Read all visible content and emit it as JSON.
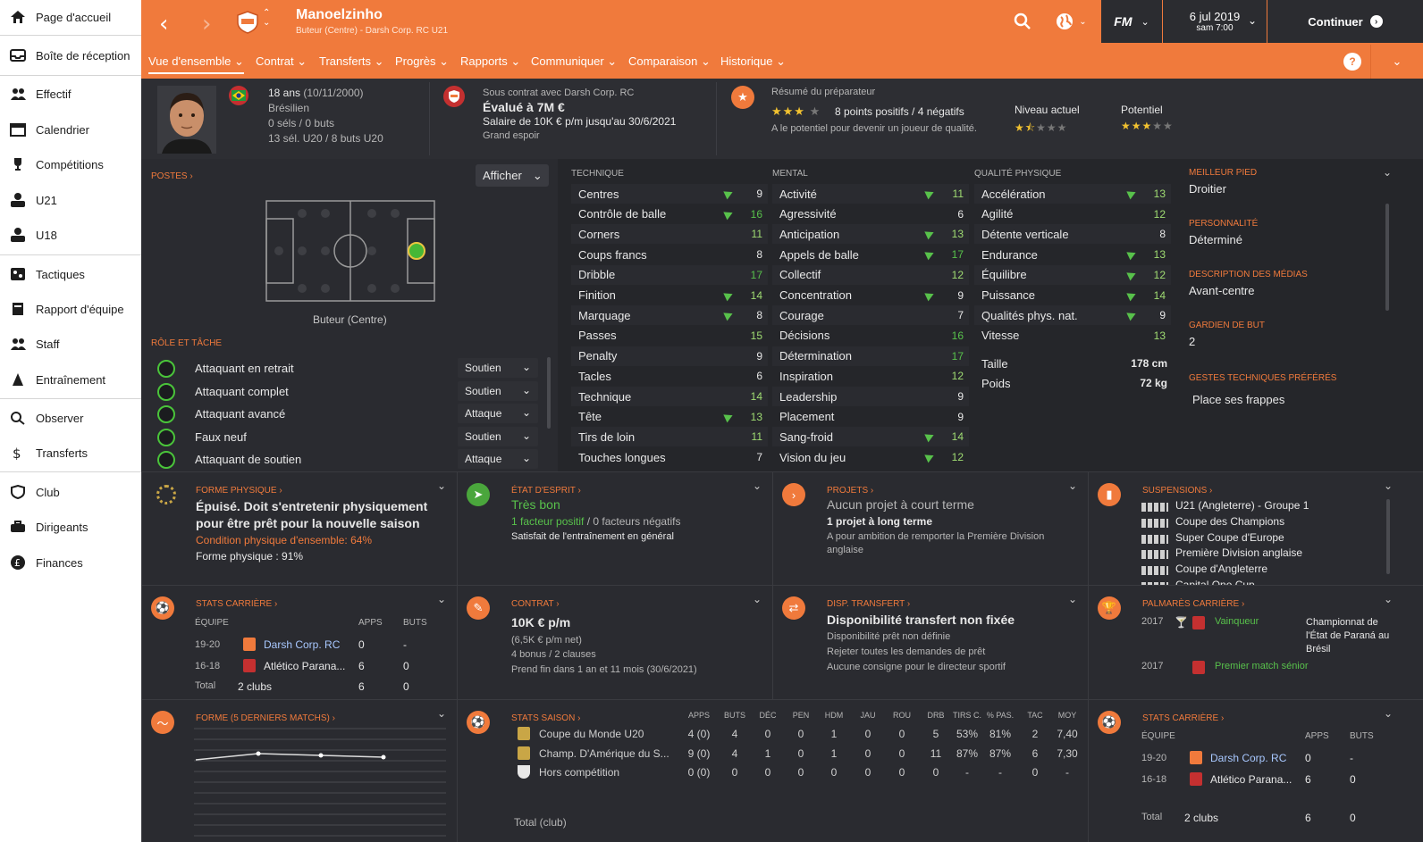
{
  "sidebar": {
    "items": [
      {
        "label": "Page d'accueil",
        "icon": "home-icon"
      },
      {
        "label": "Boîte de réception",
        "icon": "inbox-icon"
      },
      {
        "label": "Effectif",
        "icon": "squad-icon"
      },
      {
        "label": "Calendrier",
        "icon": "calendar-icon"
      },
      {
        "label": "Compétitions",
        "icon": "trophy-icon"
      },
      {
        "label": "U21",
        "icon": "u21-icon"
      },
      {
        "label": "U18",
        "icon": "u18-icon"
      },
      {
        "label": "Tactiques",
        "icon": "tactics-icon"
      },
      {
        "label": "Rapport d'équipe",
        "icon": "report-icon"
      },
      {
        "label": "Staff",
        "icon": "staff-icon"
      },
      {
        "label": "Entraînement",
        "icon": "training-icon"
      },
      {
        "label": "Observer",
        "icon": "search-icon"
      },
      {
        "label": "Transferts",
        "icon": "transfer-icon"
      },
      {
        "label": "Club",
        "icon": "shield-icon"
      },
      {
        "label": "Dirigeants",
        "icon": "board-icon"
      },
      {
        "label": "Finances",
        "icon": "finance-icon"
      }
    ]
  },
  "topbar": {
    "name": "Manoelzinho",
    "subtitle": "Buteur (Centre) - Darsh Corp. RC U21",
    "fm": "FM",
    "date": "6 jul 2019",
    "time": "sam 7:00",
    "continue": "Continuer",
    "help": "?"
  },
  "menu": [
    "Vue d'ensemble",
    "Contrat",
    "Transferts",
    "Progrès",
    "Rapports",
    "Communiquer",
    "Comparaison",
    "Historique"
  ],
  "header": {
    "age": "18 ans",
    "dob": "(10/11/2000)",
    "nationality": "Brésilien",
    "caps": "0 séls / 0 buts",
    "u20": "13 sél. U20 / 8 buts U20",
    "contract": "Sous contrat avec Darsh Corp. RC",
    "value": "Évalué à 7M €",
    "salary": "Salaire de 10K € p/m jusqu'au 30/6/2021",
    "status": "Grand espoir",
    "coach_title": "Résumé du préparateur",
    "coach_points": "8 points positifs / 4 négatifs",
    "coach_note": "A le potentiel pour devenir un joueur de qualité.",
    "coach_stars": 3,
    "current_label": "Niveau actuel",
    "current_stars": 1.5,
    "potential_label": "Potentiel",
    "potential_stars": 3
  },
  "positions": {
    "title": "POSTES",
    "show": "Afficher",
    "position": "Buteur (Centre)",
    "roles_title": "RÔLE ET TÂCHE",
    "roles": [
      {
        "name": "Attaquant en retrait",
        "duty": "Soutien"
      },
      {
        "name": "Attaquant complet",
        "duty": "Soutien"
      },
      {
        "name": "Attaquant avancé",
        "duty": "Attaque"
      },
      {
        "name": "Faux neuf",
        "duty": "Soutien"
      },
      {
        "name": "Attaquant de soutien",
        "duty": "Attaque"
      }
    ]
  },
  "attributes": {
    "technique_title": "TECHNIQUE",
    "mental_title": "MENTAL",
    "physical_title": "QUALITÉ PHYSIQUE",
    "technique": [
      {
        "n": "Centres",
        "v": "9",
        "up": true
      },
      {
        "n": "Contrôle de balle",
        "v": "16",
        "up": true
      },
      {
        "n": "Corners",
        "v": "11",
        "up": false
      },
      {
        "n": "Coups francs",
        "v": "8",
        "up": false
      },
      {
        "n": "Dribble",
        "v": "17",
        "up": false
      },
      {
        "n": "Finition",
        "v": "14",
        "up": true
      },
      {
        "n": "Marquage",
        "v": "8",
        "up": true
      },
      {
        "n": "Passes",
        "v": "15",
        "up": false
      },
      {
        "n": "Penalty",
        "v": "9",
        "up": false
      },
      {
        "n": "Tacles",
        "v": "6",
        "up": false
      },
      {
        "n": "Technique",
        "v": "14",
        "up": false
      },
      {
        "n": "Tête",
        "v": "13",
        "up": true
      },
      {
        "n": "Tirs de loin",
        "v": "11",
        "up": false
      },
      {
        "n": "Touches longues",
        "v": "7",
        "up": false
      }
    ],
    "mental": [
      {
        "n": "Activité",
        "v": "11",
        "up": true
      },
      {
        "n": "Agressivité",
        "v": "6",
        "up": false
      },
      {
        "n": "Anticipation",
        "v": "13",
        "up": true
      },
      {
        "n": "Appels de balle",
        "v": "17",
        "up": true
      },
      {
        "n": "Collectif",
        "v": "12",
        "up": false
      },
      {
        "n": "Concentration",
        "v": "9",
        "up": true
      },
      {
        "n": "Courage",
        "v": "7",
        "up": false
      },
      {
        "n": "Décisions",
        "v": "16",
        "up": false
      },
      {
        "n": "Détermination",
        "v": "17",
        "up": false
      },
      {
        "n": "Inspiration",
        "v": "12",
        "up": false
      },
      {
        "n": "Leadership",
        "v": "9",
        "up": false
      },
      {
        "n": "Placement",
        "v": "9",
        "up": false
      },
      {
        "n": "Sang-froid",
        "v": "14",
        "up": true
      },
      {
        "n": "Vision du jeu",
        "v": "12",
        "up": true
      }
    ],
    "physical": [
      {
        "n": "Accélération",
        "v": "13",
        "up": true
      },
      {
        "n": "Agilité",
        "v": "12",
        "up": false
      },
      {
        "n": "Détente verticale",
        "v": "8",
        "up": false
      },
      {
        "n": "Endurance",
        "v": "13",
        "up": true
      },
      {
        "n": "Équilibre",
        "v": "12",
        "up": true
      },
      {
        "n": "Puissance",
        "v": "14",
        "up": true
      },
      {
        "n": "Qualités phys. nat.",
        "v": "9",
        "up": true
      },
      {
        "n": "Vitesse",
        "v": "13",
        "up": false
      }
    ],
    "height_label": "Taille",
    "height": "178 cm",
    "weight_label": "Poids",
    "weight": "72 kg"
  },
  "info": {
    "foot_title": "MEILLEUR PIED",
    "foot": "Droitier",
    "pers_title": "PERSONNALITÉ",
    "pers": "Déterminé",
    "media_title": "DESCRIPTION DES MÉDIAS",
    "media": "Avant-centre",
    "gk_title": "GARDIEN DE BUT",
    "gk": "2",
    "ppm_title": "GESTES TECHNIQUES PRÉFÉRÉS",
    "ppm": "Place ses frappes"
  },
  "cards": {
    "form_title": "FORME PHYSIQUE",
    "form_head": "Épuisé. Doit s'entretenir physiquement pour être prêt pour la nouvelle saison",
    "form_cond": "Condition physique d'ensemble: 64%",
    "form_phys": "Forme physique : 91%",
    "morale_title": "ÉTAT D'ESPRIT",
    "morale": "Très bon",
    "morale_pos": "1 facteur positif",
    "morale_neg": "/ 0 facteurs négatifs",
    "morale_note": "Satisfait de l'entraînement en général",
    "plans_title": "PROJETS",
    "plans_short": "Aucun projet à court terme",
    "plans_long": "1 projet à long terme",
    "plans_note": "A pour ambition de remporter la Première Division anglaise",
    "susp_title": "SUSPENSIONS",
    "susp": [
      "U21 (Angleterre) - Groupe 1",
      "Coupe des Champions",
      "Super Coupe d'Europe",
      "Première Division anglaise",
      "Coupe d'Angleterre",
      "Capital One Cup"
    ],
    "career_title": "STATS CARRIÈRE",
    "career_cols": [
      "ÉQUIPE",
      "APPS",
      "BUTS"
    ],
    "career_rows": [
      {
        "s": "19-20",
        "t": "Darsh Corp. RC",
        "a": "0",
        "b": "-"
      },
      {
        "s": "16-18",
        "t": "Atlético Parana...",
        "a": "6",
        "b": "0"
      }
    ],
    "career_total": {
      "s": "Total",
      "t": "2 clubs",
      "a": "6",
      "b": "0"
    },
    "contract_title": "CONTRAT",
    "contract_wage": "10K € p/m",
    "contract_net": "(6,5K € p/m net)",
    "contract_bonus": "4 bonus / 2 clauses",
    "contract_end": "Prend fin dans 1 an et 11 mois",
    "contract_date": "(30/6/2021)",
    "transfer_title": "DISP. TRANSFERT",
    "transfer_head": "Disponibilité transfert non fixée",
    "transfer_l1": "Disponibilité prêt non définie",
    "transfer_l2": "Rejeter toutes les demandes de prêt",
    "transfer_l3": "Aucune consigne pour le directeur sportif",
    "honours_title": "PALMARÈS CARRIÈRE",
    "honours": [
      {
        "y": "2017",
        "r": "Vainqueur",
        "c": "Championnat de l'État de Paraná au Brésil"
      },
      {
        "y": "2017",
        "r": "Premier match sénior",
        "c": ""
      }
    ],
    "formlast_title": "FORME (5 DERNIERS MATCHS)",
    "season_title": "STATS SAISON",
    "season_cols": [
      "APPS",
      "BUTS",
      "DÉC",
      "PEN",
      "HDM",
      "JAU",
      "ROU",
      "DRB",
      "TIRS C.",
      "% PAS.",
      "TAC",
      "MOY"
    ],
    "season_rows": [
      {
        "c": "Coupe du Monde U20",
        "v": [
          "4 (0)",
          "4",
          "0",
          "0",
          "1",
          "0",
          "0",
          "5",
          "53%",
          "81%",
          "2",
          "7,40"
        ]
      },
      {
        "c": "Champ. D'Amérique du S...",
        "v": [
          "9 (0)",
          "4",
          "1",
          "0",
          "1",
          "0",
          "0",
          "11",
          "87%",
          "87%",
          "6",
          "7,30"
        ]
      },
      {
        "c": "Hors compétition",
        "v": [
          "0 (0)",
          "0",
          "0",
          "0",
          "0",
          "0",
          "0",
          "0",
          "-",
          "-",
          "0",
          "-"
        ]
      }
    ],
    "season_total": "Total (club)"
  },
  "colors": {
    "accent": "#f07a3c",
    "green": "#58c14b",
    "bg": "#25262a"
  }
}
